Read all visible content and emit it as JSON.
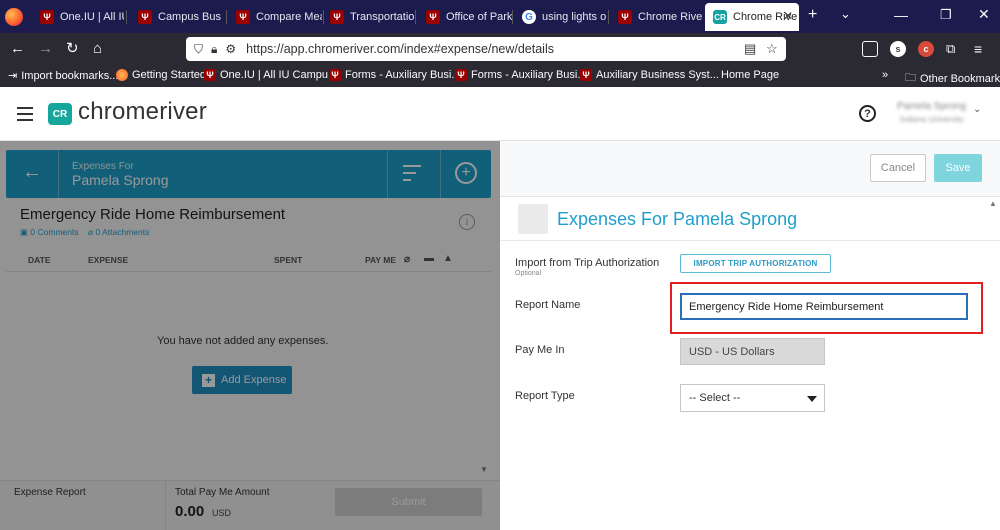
{
  "browser": {
    "tabs": [
      {
        "label": "One.IU | All IU",
        "icon": "iu-trident-icon"
      },
      {
        "label": "Campus Bus Se",
        "icon": "iu-trident-icon"
      },
      {
        "label": "Compare Meal",
        "icon": "iu-trident-icon"
      },
      {
        "label": "Transportation",
        "icon": "iu-trident-icon"
      },
      {
        "label": "Office of Parki",
        "icon": "iu-trident-icon"
      },
      {
        "label": "using lights on",
        "icon": "google-icon"
      },
      {
        "label": "Chrome River T",
        "icon": "iu-trident-icon"
      },
      {
        "label": "Chrome Rive",
        "icon": "chromeriver-icon",
        "active": true
      }
    ],
    "url": "https://app.chromeriver.com/index#expense/new/details",
    "bookmarks": [
      "Import bookmarks...",
      "Getting Started",
      "One.IU | All IU Campu...",
      "Forms - Auxiliary Busi...",
      "Forms - Auxiliary Busi...",
      "Auxiliary Business Syst...",
      "Home Page",
      "Other Bookmarks"
    ],
    "extensions": [
      "pocket-icon",
      "s",
      "c",
      "puzzle-icon",
      "menu-icon"
    ]
  },
  "app": {
    "logo_mark": "CR",
    "logo_text": "chromeriver",
    "help": "?",
    "user_name": "Pamela Sprong",
    "user_org": "Indiana University"
  },
  "left": {
    "header_label": "Expenses For",
    "header_name": "Pamela Sprong",
    "report_title": "Emergency Ride Home Reimbursement",
    "comments": "0 Comments",
    "attachments": "0 Attachments",
    "columns": [
      "DATE",
      "EXPENSE",
      "SPENT",
      "PAY ME"
    ],
    "empty_message": "You have not added any expenses.",
    "add_expense": "Add Expense",
    "footer_label": "Expense Report",
    "total_label": "Total Pay Me Amount",
    "total_amount": "0.00",
    "total_currency": "USD",
    "submit": "Submit"
  },
  "right": {
    "cancel": "Cancel",
    "save": "Save",
    "title": "Expenses For Pamela Sprong",
    "fields": {
      "import_label": "Import from Trip Authorization",
      "import_sub": "Optional",
      "import_button": "IMPORT TRIP AUTHORIZATION",
      "report_name_label": "Report Name",
      "report_name_value": "Emergency Ride Home Reimbursement",
      "pay_me_label": "Pay Me In",
      "pay_me_value": "USD - US Dollars",
      "report_type_label": "Report Type",
      "report_type_value": "-- Select --"
    }
  },
  "colors": {
    "accent": "#1f9fcb",
    "brand": "#16a69c",
    "highlight": "#e02020",
    "browser_dark": "#1c1b4d"
  }
}
